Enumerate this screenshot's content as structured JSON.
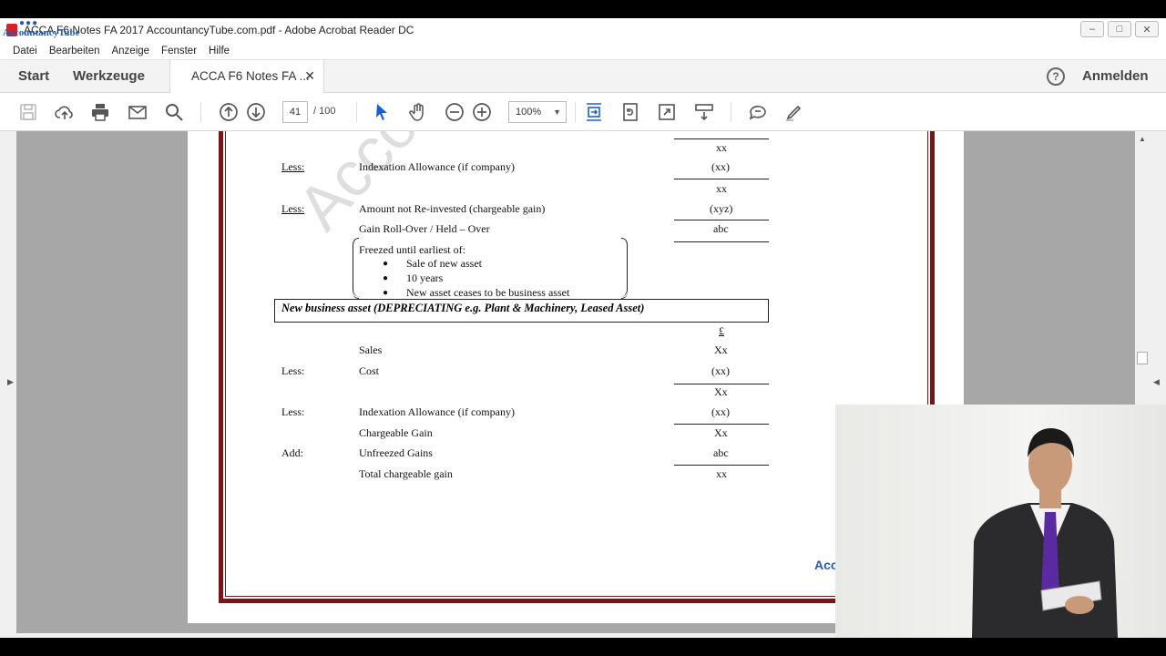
{
  "window": {
    "title": "ACCA F6 Notes FA 2017  AccountancyTube.com.pdf - Adobe Acrobat Reader DC",
    "logo_text": "AccountancyTube",
    "controls": [
      "–",
      "□",
      "✕"
    ]
  },
  "menu": {
    "items": [
      "Datei",
      "Bearbeiten",
      "Anzeige",
      "Fenster",
      "Hilfe"
    ]
  },
  "tabs": {
    "start": "Start",
    "tools": "Werkzeuge",
    "doc": "ACCA F6 Notes FA ...",
    "doc_close": "✕",
    "help": "?",
    "signin": "Anmelden"
  },
  "toolbar": {
    "page_current": "41",
    "page_total": "/  100",
    "zoom": "100%",
    "zoom_caret": "▼",
    "icons": [
      "save-icon",
      "upload-icon",
      "print-icon",
      "email-icon",
      "search-icon",
      "page-up-icon",
      "page-down-icon",
      "select-cursor-icon",
      "hand-icon",
      "zoom-out-icon",
      "zoom-in-icon",
      "fit-page-icon",
      "rotate-icon",
      "fullscreen-icon",
      "scroll-mode-icon",
      "comment-icon",
      "highlight-pen-icon"
    ]
  },
  "document": {
    "watermark": "Accounta",
    "corner_logo": "Acc",
    "section1": {
      "rows": [
        {
          "label": "",
          "desc": "",
          "amount": "xx"
        },
        {
          "label": "Less:",
          "desc": "Indexation Allowance (if company)",
          "amount": "(xx)"
        },
        {
          "label": "",
          "desc": "",
          "amount": "xx"
        },
        {
          "label": "Less:",
          "desc": "Amount not Re-invested (chargeable gain)",
          "amount": "(xyz)"
        },
        {
          "label": "",
          "desc": "Gain  Roll-Over / Held – Over",
          "amount": "abc"
        }
      ],
      "frozen_title": "Freezed until earliest of:",
      "frozen_items": [
        "Sale of new asset",
        "10 years",
        "New asset ceases to be business asset"
      ]
    },
    "section2": {
      "heading": "New business asset (DEPRECIATING e.g. Plant & Machinery, Leased Asset)",
      "currency": "£",
      "rows": [
        {
          "label": "",
          "desc": "Sales",
          "amount": "Xx"
        },
        {
          "label": "Less:",
          "desc": "Cost",
          "amount": "(xx)"
        },
        {
          "label": "",
          "desc": "",
          "amount": "Xx"
        },
        {
          "label": "Less:",
          "desc": "Indexation Allowance (if company)",
          "amount": "(xx)"
        },
        {
          "label": "",
          "desc": "Chargeable Gain",
          "amount": "Xx"
        },
        {
          "label": "Add:",
          "desc": "Unfreezed Gains",
          "amount": "abc"
        },
        {
          "label": "",
          "desc": "Total chargeable gain",
          "amount": "xx"
        }
      ]
    }
  },
  "colors": {
    "frame": "#7a1418",
    "accent": "#2a5aa8",
    "select_icon": "#1a5fd0"
  }
}
